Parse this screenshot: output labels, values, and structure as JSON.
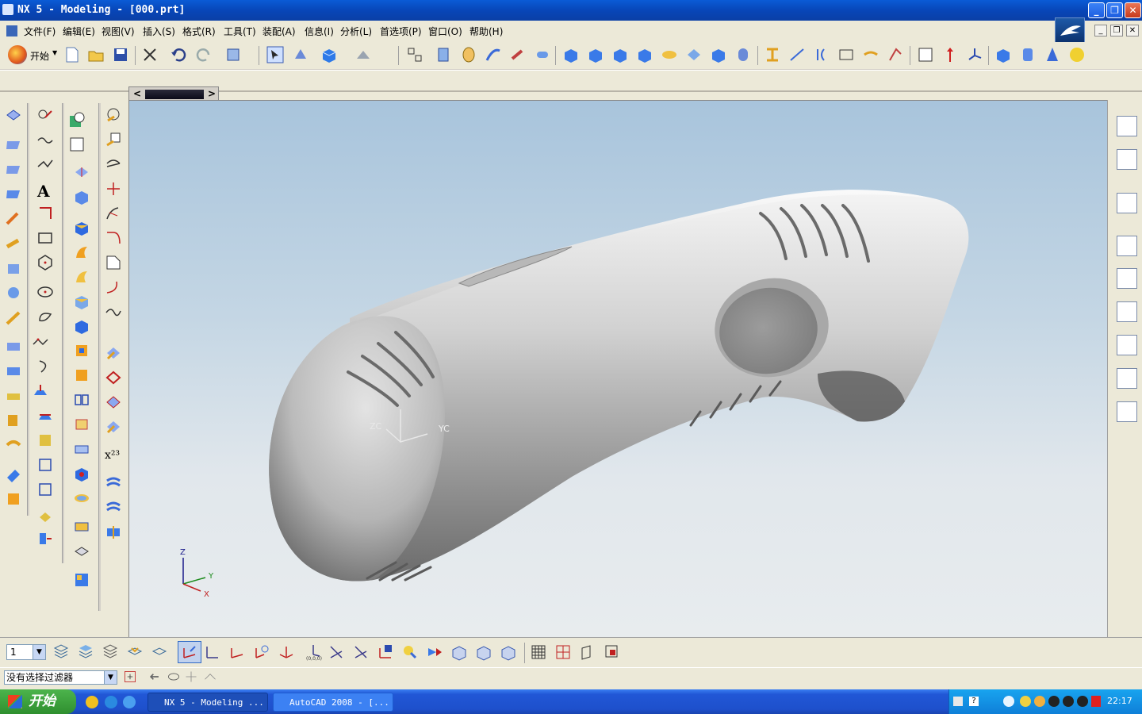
{
  "window": {
    "title": "NX 5 - Modeling - [000.prt]",
    "minimize_glyph": "_",
    "restore_glyph": "❐",
    "close_glyph": "✕"
  },
  "menu": {
    "items": [
      {
        "label": "文件(F)"
      },
      {
        "label": "编辑(E)"
      },
      {
        "label": "视图(V)"
      },
      {
        "label": "插入(S)"
      },
      {
        "label": "格式(R)"
      },
      {
        "label": "工具(T)"
      },
      {
        "label": "装配(A)"
      },
      {
        "label": "信息(I)"
      },
      {
        "label": "分析(L)"
      },
      {
        "label": "首选项(P)"
      },
      {
        "label": "窗口(O)"
      },
      {
        "label": "帮助(H)"
      }
    ]
  },
  "toolbar": {
    "start_label": "开始"
  },
  "scroller": {
    "left_glyph": "<",
    "right_glyph": ">"
  },
  "viewport": {
    "wcs_zc": "ZC",
    "wcs_yc": "YC",
    "triad_z": "Z",
    "triad_y": "Y",
    "triad_x": "X",
    "exponent_icon_text": "x²³",
    "text_tool_glyph": "A"
  },
  "bottombar": {
    "layer_value": "1"
  },
  "status": {
    "selection_filter": "没有选择过滤器"
  },
  "taskbar": {
    "start_label": "开始",
    "tasks": [
      {
        "label": "NX 5 - Modeling ..."
      },
      {
        "label": "AutoCAD 2008 - [..."
      }
    ],
    "clock": "22:17"
  },
  "colors": {
    "titlebar": "#0a4fc4",
    "chrome": "#ece9d8",
    "viewport_top": "#a8c4dc",
    "viewport_bottom": "#e8ecee",
    "taskbar": "#2157d6"
  }
}
